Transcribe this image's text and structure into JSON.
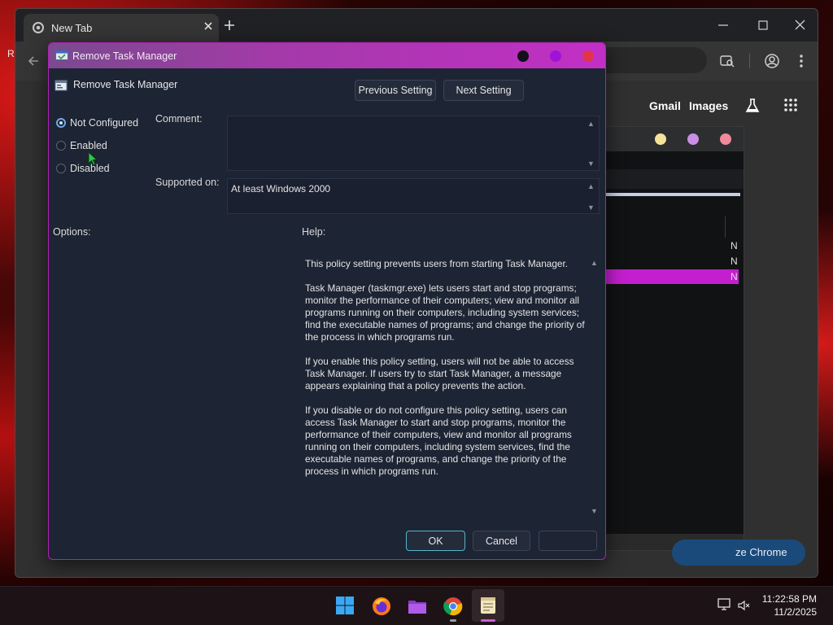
{
  "browser": {
    "tab_title": "New Tab",
    "links": {
      "gmail": "Gmail",
      "images": "Images"
    },
    "customize_label": "ze Chrome",
    "desktop_edge_text": "R"
  },
  "background_window": {
    "row_letters": [
      "N",
      "N",
      "N"
    ]
  },
  "dialog": {
    "title": "Remove Task Manager",
    "header_title": "Remove Task Manager",
    "prev_button": "Previous Setting",
    "next_button": "Next Setting",
    "radio_options": [
      {
        "label": "Not Configured",
        "selected": true
      },
      {
        "label": "Enabled",
        "selected": false
      },
      {
        "label": "Disabled",
        "selected": false
      }
    ],
    "comment_label": "Comment:",
    "comment_value": "",
    "supported_label": "Supported on:",
    "supported_value": "At least Windows 2000",
    "options_label": "Options:",
    "help_label": "Help:",
    "help_text": "This policy setting prevents users from starting Task Manager.\n\nTask Manager (taskmgr.exe) lets users start and stop programs; monitor the performance of their computers; view and monitor all programs running on their computers, including system services; find the executable names of programs; and change the priority of the process in which programs run.\n\nIf you enable this policy setting, users will not be able to access Task Manager. If users try to start Task Manager, a message appears explaining that a policy prevents the action.\n\nIf you disable or do not configure this policy setting, users can access Task Manager to  start and stop programs, monitor the performance of their computers, view and monitor all programs running on their computers, including system services, find the executable names of programs, and change the priority of the process in which programs run.",
    "ok_button": "OK",
    "cancel_button": "Cancel",
    "apply_button": "",
    "titlebar_colors": {
      "start": "#7a4a8f",
      "end": "#c22fc6"
    },
    "title_dots": [
      "#150f1c",
      "#a012d8",
      "#e2334a"
    ]
  },
  "taskbar": {
    "apps": [
      "start-icon",
      "firefox-icon",
      "file-explorer-icon",
      "chrome-icon",
      "notepad-icon"
    ],
    "clock_time": "11:22:58 PM",
    "clock_date": "11/2/2025"
  },
  "colors": {
    "accent_magenta": "#c41fcf",
    "radio_selected": "#6ea8e8",
    "dialog_bg": "#1d2433"
  }
}
